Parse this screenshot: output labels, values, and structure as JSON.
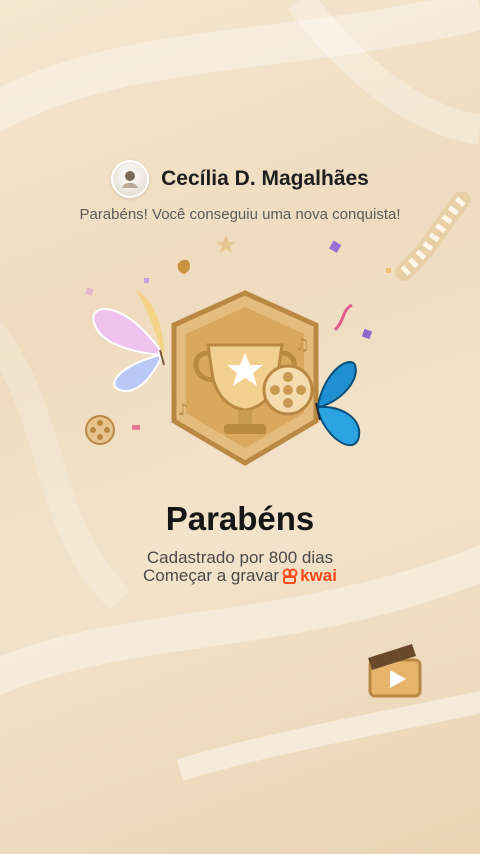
{
  "user": {
    "name": "Cecília D. Magalhães"
  },
  "achievement": {
    "subtitle": "Parabéns! Você conseguiu uma nova conquista!",
    "title": "Parabéns",
    "line1": "Cadastrado por 800 dias",
    "line2": "Começar a gravar",
    "brand": "kwai"
  },
  "colors": {
    "brand": "#ff4a1c",
    "badge_gold": "#d8a65a",
    "butterfly_blue": "#1e8fd0",
    "butterfly_pink": "#e9a6e8"
  }
}
